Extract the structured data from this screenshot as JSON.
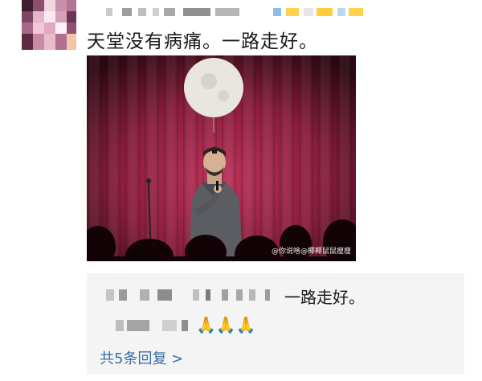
{
  "post": {
    "comment": "天堂没有病痛。一路走好。",
    "photo_watermark": "@你说啥@椰椰鼠鼠瘦瘦"
  },
  "replies": {
    "first_reply_text": "一路走好。",
    "second_reply_emoji": "🙏🙏🙏",
    "more_replies_link": "共5条回复 >"
  },
  "colors": {
    "link": "#3b6ea3",
    "reply_bg": "#f4f4f4",
    "curtain": "#8a1c3c"
  }
}
